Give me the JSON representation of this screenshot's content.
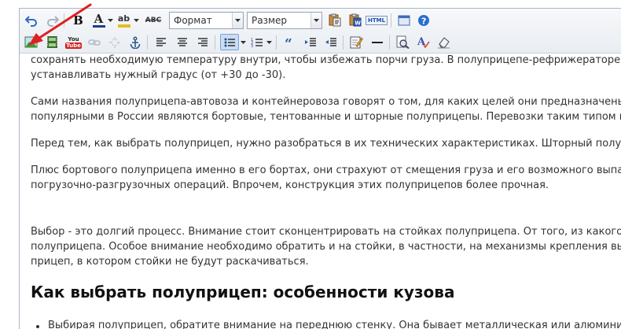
{
  "toolbar": {
    "format_label": "Формат",
    "size_label": "Размер",
    "bold_label": "B",
    "font_color_label": "A",
    "highlight_label": "ab",
    "remove_format_label": "ABC",
    "youtube_top_label": "You",
    "youtube_bottom_label": "Tube",
    "html_label": "HTML",
    "row1_icons": [
      "undo-icon",
      "redo-icon",
      "bold-icon",
      "font-color-icon",
      "highlight-color-icon",
      "strikethrough-format-icon",
      "paste-text-icon",
      "paste-word-icon",
      "html-icon",
      "fullscreen-icon",
      "help-icon"
    ],
    "row2_icons": [
      "insert-image-icon",
      "insert-video-icon",
      "youtube-icon",
      "link-icon",
      "unlink-icon",
      "anchor-icon",
      "align-left-icon",
      "align-center-icon",
      "align-right-icon",
      "bulleted-list-icon",
      "numbered-list-icon",
      "blockquote-icon",
      "indent-icon",
      "outdent-icon",
      "edit-icon",
      "horizontal-rule-icon",
      "preview-icon",
      "spellcheck-icon",
      "eraser-icon"
    ]
  },
  "content": {
    "lines": [
      "сохранять необходимую температуру внутри, чтобы избежать порчи груза. В полуприцепе-рефрижераторе, мо",
      "устанавливать нужный градус (от +30 до -30).",
      "Сами названия полуприцепа-автовоза и контейнеровоза говорят о том, для каких целей они предназначены.",
      "популярными в России являются бортовые, тентованные и шторные полуприцепы. Перевозки таким типом п",
      "Перед тем, как выбрать полуприцеп, нужно разобраться в их технических характеристиках. Шторный полуп",
      "Плюс бортового полуприцепа именно в его бортах, они страхуют от смещения груза и его возможного выпа",
      "погрузочно-разгрузочных операций. Впрочем, конструкция этих полуприцепов более прочная.",
      "Выбор - это долгий процесс. Внимание стоит сконцентрировать на стойках полуприцепа. От того, из какого",
      "полуприцепа. Особое внимание необходимо обратить и на стойки, в частности, на механизмы крепления вь",
      "прицеп, в котором стойки не будут раскачиваться."
    ],
    "heading": "Как выбрать полуприцеп: особенности кузова",
    "bullet_item": "Выбирая полуприцеп, обратите внимание на переднюю стенку. Она бывает металлическая или алюмини"
  },
  "colors": {
    "arrow": "#e02020",
    "text": "#333333",
    "toolbar_bg": "#eef1f5",
    "accent": "#2a6fcf"
  }
}
